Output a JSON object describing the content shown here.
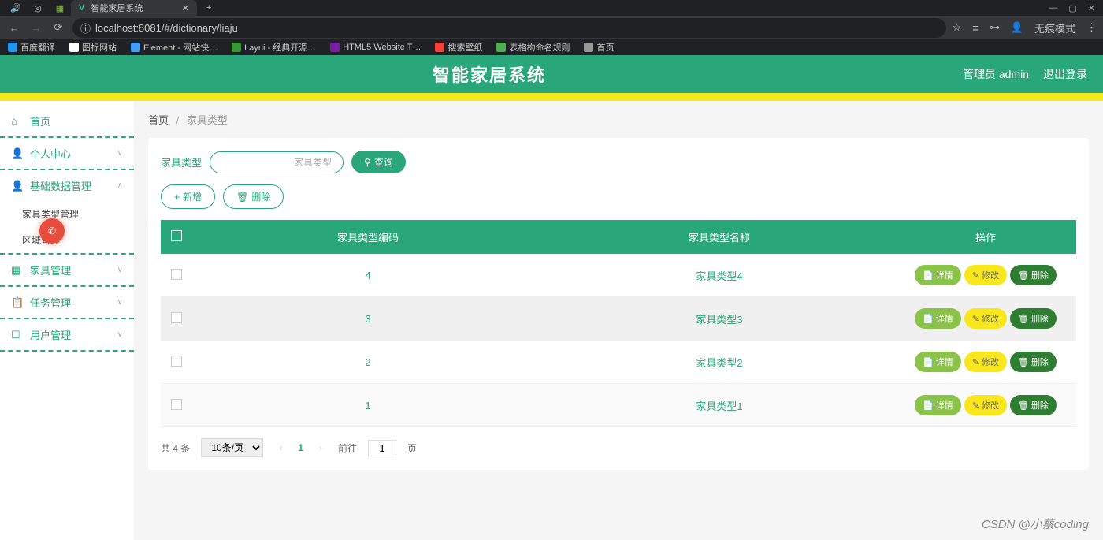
{
  "browser": {
    "tab_title": "智能家居系统",
    "url": "localhost:8081/#/dictionary/liaju",
    "window_buttons": {
      "min": "—",
      "max": "▢",
      "close": "✕"
    },
    "incognito_label": "无痕模式",
    "bookmarks": [
      {
        "label": "百度翻译"
      },
      {
        "label": "图标网站"
      },
      {
        "label": "Element - 网站快…"
      },
      {
        "label": "Layui - 经典开源…"
      },
      {
        "label": "HTML5 Website T…"
      },
      {
        "label": "搜索壁纸"
      },
      {
        "label": "表格构命名规则"
      },
      {
        "label": "首页"
      }
    ]
  },
  "header": {
    "title": "智能家居系统",
    "user_prefix": "管理员",
    "username": "admin",
    "logout": "退出登录"
  },
  "sidebar": {
    "items": [
      {
        "icon": "⌂",
        "label": "首页",
        "sub": false
      },
      {
        "icon": "👤",
        "label": "个人中心",
        "sub": true
      },
      {
        "icon": "👤",
        "label": "基础数据管理",
        "sub": true,
        "expanded": true,
        "children": [
          {
            "label": "家具类型管理"
          },
          {
            "label": "区域管理"
          }
        ]
      },
      {
        "icon": "▦",
        "label": "家具管理",
        "sub": true
      },
      {
        "icon": "📋",
        "label": "任务管理",
        "sub": true
      },
      {
        "icon": "☐",
        "label": "用户管理",
        "sub": true
      }
    ]
  },
  "breadcrumb": {
    "home": "首页",
    "current": "家具类型"
  },
  "search": {
    "label": "家具类型",
    "placeholder": "家具类型",
    "query_btn": "查询"
  },
  "actions": {
    "add": "新增",
    "delete": "删除"
  },
  "table": {
    "headers": [
      "",
      "家具类型编码",
      "家具类型名称",
      "操作"
    ],
    "op_labels": {
      "detail": "详情",
      "edit": "修改",
      "delete": "删除"
    },
    "rows": [
      {
        "code": "4",
        "name": "家具类型4"
      },
      {
        "code": "3",
        "name": "家具类型3"
      },
      {
        "code": "2",
        "name": "家具类型2"
      },
      {
        "code": "1",
        "name": "家具类型1"
      }
    ]
  },
  "pagination": {
    "total_text": "共 4 条",
    "page_size": "10条/页",
    "current": "1",
    "goto_prefix": "前往",
    "goto_value": "1",
    "goto_suffix": "页"
  },
  "watermark": "CSDN @小蔡coding"
}
